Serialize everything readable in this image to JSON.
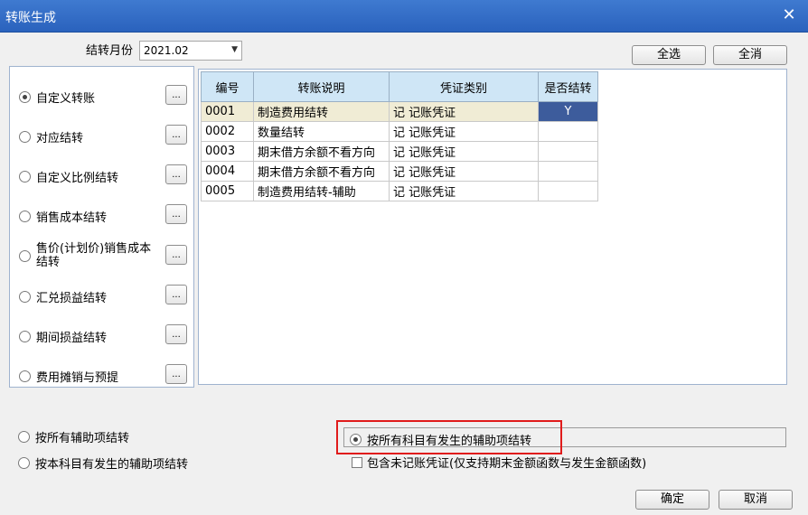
{
  "window": {
    "title": "转账生成",
    "close_glyph": "✕"
  },
  "month": {
    "label": "结转月份",
    "value": "2021.02"
  },
  "actions": {
    "select_all": "全选",
    "clear_all": "全消",
    "ok": "确定",
    "cancel": "取消"
  },
  "transfer_types": [
    {
      "label": "自定义转账",
      "selected": true
    },
    {
      "label": "对应结转",
      "selected": false
    },
    {
      "label": "自定义比例结转",
      "selected": false
    },
    {
      "label": "销售成本结转",
      "selected": false
    },
    {
      "label": "售价(计划价)销售成本结转",
      "selected": false
    },
    {
      "label": "汇兑损益结转",
      "selected": false
    },
    {
      "label": "期间损益结转",
      "selected": false
    },
    {
      "label": "费用摊销与预提",
      "selected": false
    }
  ],
  "ellipsis": "...",
  "table": {
    "headers": [
      "编号",
      "转账说明",
      "凭证类别",
      "是否结转"
    ],
    "rows": [
      {
        "id": "0001",
        "desc": "制造费用结转",
        "voucher": "记 记账凭证",
        "done": "Y"
      },
      {
        "id": "0002",
        "desc": "数量结转",
        "voucher": "记 记账凭证",
        "done": ""
      },
      {
        "id": "0003",
        "desc": "期末借方余额不看方向",
        "voucher": "记 记账凭证",
        "done": ""
      },
      {
        "id": "0004",
        "desc": "期末借方余额不看方向",
        "voucher": "记 记账凭证",
        "done": ""
      },
      {
        "id": "0005",
        "desc": "制造费用结转-辅助",
        "voucher": "记 记账凭证",
        "done": ""
      }
    ]
  },
  "aux_options": {
    "all_aux": "按所有辅助项结转",
    "subject_aux": "按本科目有发生的辅助项结转",
    "all_subject_aux": "按所有科目有发生的辅助项结转",
    "include_unposted": "包含未记账凭证(仅支持期末金额函数与发生金额函数)"
  },
  "colors": {
    "title_bar": "#2a62bd",
    "selected_cell": "#3d5c9c",
    "header_bg": "#cfe6f6",
    "highlight": "#e01b1b"
  }
}
